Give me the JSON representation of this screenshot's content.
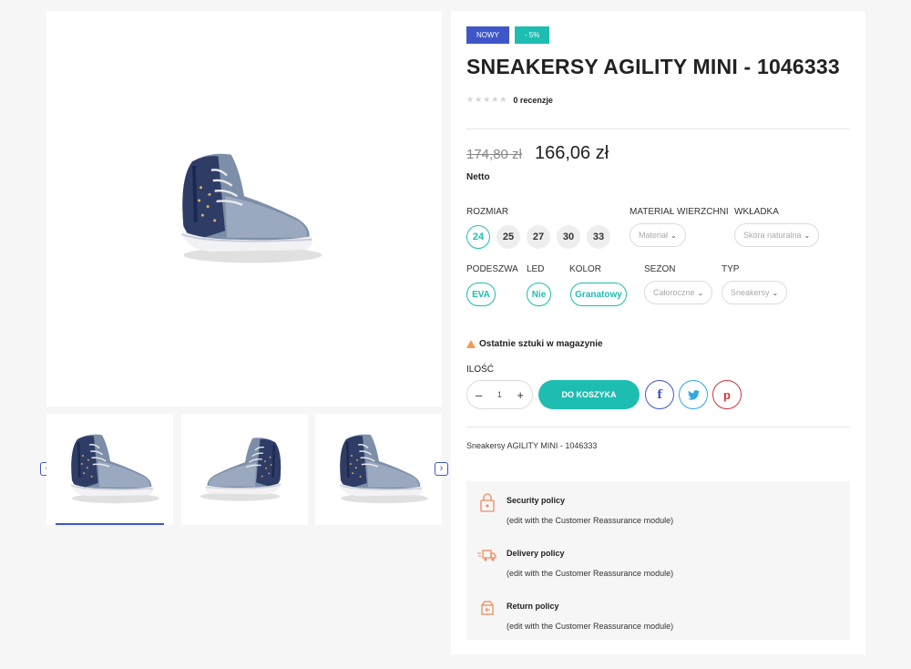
{
  "badges": {
    "new": "NOWY",
    "discount": "- 5%"
  },
  "product": {
    "title": "SNEAKERSY AGILITY MINI - 1046333",
    "reviews": "0 recenzje",
    "stars": "★★★★★",
    "old_price": "174,80 zł",
    "price": "166,06 zł",
    "netto": "Netto",
    "description": "Sneakersy AGILITY MINI - 1046333"
  },
  "attributes": {
    "size_label": "ROZMIAR",
    "sizes": [
      "24",
      "25",
      "27",
      "30",
      "33"
    ],
    "material_label": "MATERIAŁ WIERZCHNI",
    "material_value": "Materiał",
    "insole_label": "WKŁADKA",
    "insole_value": "Skóra naturalna",
    "sole_label": "PODESZWA",
    "sole_value": "EVA",
    "led_label": "LED",
    "led_value": "Nie",
    "color_label": "KOLOR",
    "color_value": "Granatowy",
    "season_label": "SEZON",
    "season_value": "Całoroczne",
    "type_label": "TYP",
    "type_value": "Sneakersy"
  },
  "stock_warning": "Ostatnie sztuki w magazynie",
  "quantity": {
    "label": "ILOŚĆ",
    "value": "1",
    "minus": "–",
    "plus": "+"
  },
  "cart_button": "DO KOSZYKA",
  "social": {
    "facebook": "f",
    "twitter": "t",
    "pinterest": "p"
  },
  "gallery": {
    "prev": "‹",
    "next": "›"
  },
  "reassurance": [
    {
      "title": "Security policy",
      "text": "(edit with the Customer Reassurance module)",
      "icon": "lock-icon"
    },
    {
      "title": "Delivery policy",
      "text": "(edit with the Customer Reassurance module)",
      "icon": "truck-icon"
    },
    {
      "title": "Return policy",
      "text": "(edit with the Customer Reassurance module)",
      "icon": "return-box-icon"
    }
  ],
  "colors": {
    "accent": "#1ebdb1",
    "brand_blue": "#3f56c9",
    "warning": "#f39c4c"
  }
}
